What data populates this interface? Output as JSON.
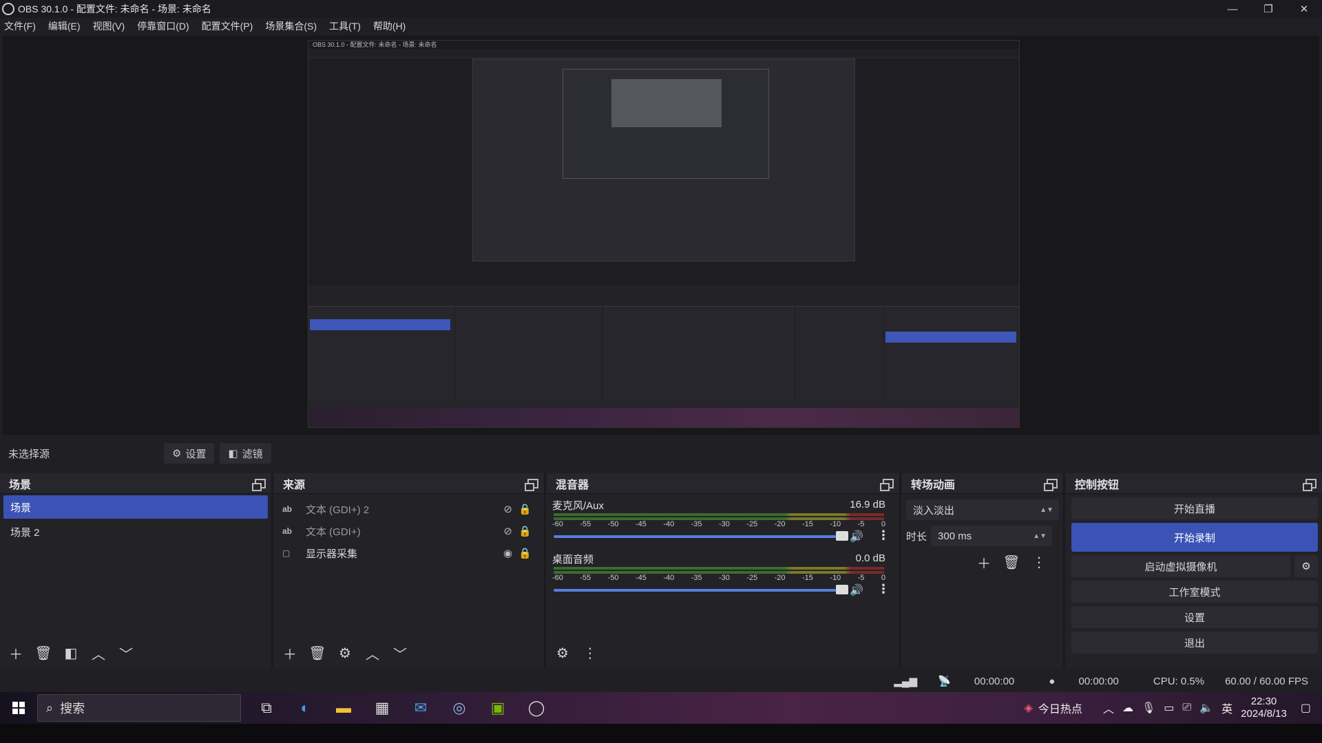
{
  "window": {
    "title": "OBS 30.1.0 - 配置文件: 未命名 - 场景: 未命名",
    "controls": [
      "—",
      "❐",
      "✕"
    ]
  },
  "menu": [
    "文件(F)",
    "编辑(E)",
    "视图(V)",
    "停靠窗口(D)",
    "配置文件(P)",
    "场景集合(S)",
    "工具(T)",
    "帮助(H)"
  ],
  "source_toolbar": {
    "no_source": "未选择源",
    "settings": "设置",
    "filters": "滤镜"
  },
  "scenes": {
    "title": "场景",
    "items": [
      "场景",
      "场景 2"
    ],
    "selected": 0
  },
  "sources": {
    "title": "来源",
    "items": [
      {
        "icon": "ab",
        "label": "文本 (GDI+) 2",
        "visible": false
      },
      {
        "icon": "ab",
        "label": "文本 (GDI+)",
        "visible": false
      },
      {
        "icon": "▢",
        "label": "显示器采集",
        "visible": true
      }
    ]
  },
  "mixer": {
    "title": "混音器",
    "channels": [
      {
        "name": "麦克风/Aux",
        "db": "16.9 dB"
      },
      {
        "name": "桌面音频",
        "db": "0.0 dB"
      }
    ],
    "ticks": [
      "-60",
      "-55",
      "-50",
      "-45",
      "-40",
      "-35",
      "-30",
      "-25",
      "-20",
      "-15",
      "-10",
      "-5",
      "0"
    ]
  },
  "transitions": {
    "title": "转场动画",
    "type": "淡入淡出",
    "duration_label": "时长",
    "duration": "300 ms"
  },
  "controls": {
    "title": "控制按钮",
    "start_stream": "开始直播",
    "start_record": "开始录制",
    "virtual_cam": "启动虚拟摄像机",
    "studio_mode": "工作室模式",
    "settings": "设置",
    "exit": "退出"
  },
  "status": {
    "stream_time": "00:00:00",
    "record_time": "00:00:00",
    "cpu": "CPU: 0.5%",
    "fps": "60.00 / 60.00 FPS"
  },
  "taskbar": {
    "search_placeholder": "搜索",
    "news": "今日热点",
    "ime": "英",
    "time": "22:30",
    "date": "2024/8/13"
  },
  "colors": {
    "accent": "#3b53b5",
    "panel": "#222227",
    "background": "#1f1f24"
  }
}
